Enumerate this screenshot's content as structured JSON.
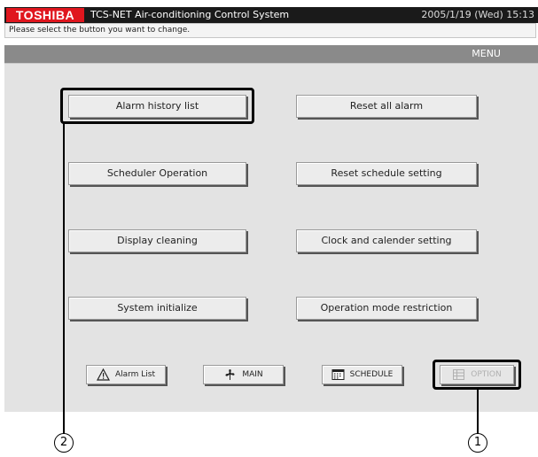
{
  "titlebar": {
    "brand": "TOSHIBA",
    "title": "TCS-NET Air-conditioning Control System",
    "datetime": "2005/1/19 (Wed)  15:13"
  },
  "hint": "Please select the button you want to change.",
  "menubar": {
    "label": "MENU"
  },
  "menu_buttons": {
    "alarm_history": "Alarm history list",
    "reset_all_alarm": "Reset all alarm",
    "scheduler_operation": "Scheduler Operation",
    "reset_schedule": "Reset schedule setting",
    "display_cleaning": "Display cleaning",
    "clock_calendar": "Clock and calender setting",
    "system_initialize": "System initialize",
    "operation_mode_restriction": "Operation mode restriction"
  },
  "nav_buttons": {
    "alarm_list": "Alarm List",
    "main": "MAIN",
    "schedule": "SCHEDULE",
    "option": "OPTION"
  },
  "callouts": {
    "one": "1",
    "two": "2"
  },
  "colors": {
    "brand_red": "#e0161e",
    "titlebar": "#1a1a1a",
    "menubar": "#8a8a8a",
    "panel": "#e3e3e3"
  },
  "icons": {
    "alarm_list": "warning-triangle-icon",
    "main": "fan-icon",
    "schedule": "calendar-icon",
    "option": "option-grid-icon"
  }
}
